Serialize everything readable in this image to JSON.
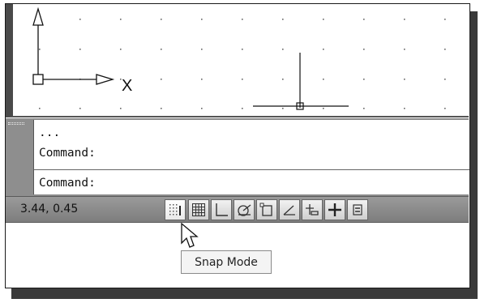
{
  "canvas": {
    "axis_label": "X"
  },
  "command_window": {
    "lines": [
      "...",
      "Command:",
      "Command:"
    ]
  },
  "status_bar": {
    "coordinates": "3.44, 0.45",
    "buttons": [
      {
        "name": "snap-mode-icon",
        "active": true
      },
      {
        "name": "grid-display-icon",
        "active": false
      },
      {
        "name": "ortho-mode-icon",
        "active": false
      },
      {
        "name": "polar-tracking-icon",
        "active": false
      },
      {
        "name": "object-snap-icon",
        "active": false
      },
      {
        "name": "object-snap-tracking-icon",
        "active": false
      },
      {
        "name": "dynamic-ucs-icon",
        "active": false
      },
      {
        "name": "dynamic-input-icon",
        "active": false
      },
      {
        "name": "lineweight-icon",
        "active": false
      }
    ]
  },
  "tooltip": {
    "text": "Snap Mode"
  },
  "colors": {
    "status_bar": "#8a8a8a",
    "frame_border": "#1a1a1a",
    "shadow": "#3a3a3a"
  }
}
